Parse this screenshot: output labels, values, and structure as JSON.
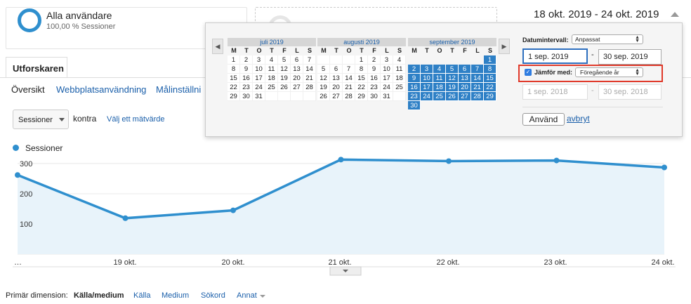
{
  "segment": {
    "title": "Alla användare",
    "subtitle": "100,00 % Sessioner"
  },
  "date_range": "18 okt. 2019 - 24 okt. 2019",
  "tabs": {
    "active": "Utforskaren"
  },
  "subnav": [
    "Översikt",
    "Webbplatsanvändning",
    "Målinställni"
  ],
  "metric": {
    "selected": "Sessioner",
    "versus": "kontra",
    "pick_label": "Välj ett mätvärde"
  },
  "legend": "Sessioner",
  "chart_data": {
    "type": "area",
    "series": [
      {
        "name": "Sessioner",
        "values": [
          262,
          119,
          145,
          313,
          308,
          310,
          287
        ]
      }
    ],
    "categories": [
      "…",
      "19 okt.",
      "20 okt.",
      "21 okt.",
      "22 okt.",
      "23 okt.",
      "24 okt."
    ],
    "y_ticks": [
      100,
      200,
      300
    ],
    "ylim": [
      0,
      330
    ],
    "grid": true,
    "color": "#2f8fce"
  },
  "primary_dimension": {
    "label": "Primär dimension:",
    "active": "Källa/medium",
    "links": [
      "Källa",
      "Medium",
      "Sökord",
      "Annat"
    ]
  },
  "picker": {
    "prev": "◀",
    "next": "▶",
    "weekdays": [
      "M",
      "T",
      "O",
      "T",
      "F",
      "L",
      "S"
    ],
    "months": [
      {
        "name": "juli 2019",
        "offset": 0,
        "days": 31,
        "selected": []
      },
      {
        "name": "augusti 2019",
        "offset": 3,
        "days": 31,
        "selected": []
      },
      {
        "name": "september 2019",
        "offset": 6,
        "days": 30,
        "selected": "all"
      }
    ],
    "range_label": "Datumintervall:",
    "range_type": "Anpassat",
    "start": "1 sep. 2019",
    "end": "30 sep. 2019",
    "compare_label": "Jämför med:",
    "compare_type": "Föregående år",
    "compare_start": "1 sep. 2018",
    "compare_end": "30 sep. 2018",
    "apply": "Använd",
    "cancel": "avbryt",
    "dash": "-"
  }
}
